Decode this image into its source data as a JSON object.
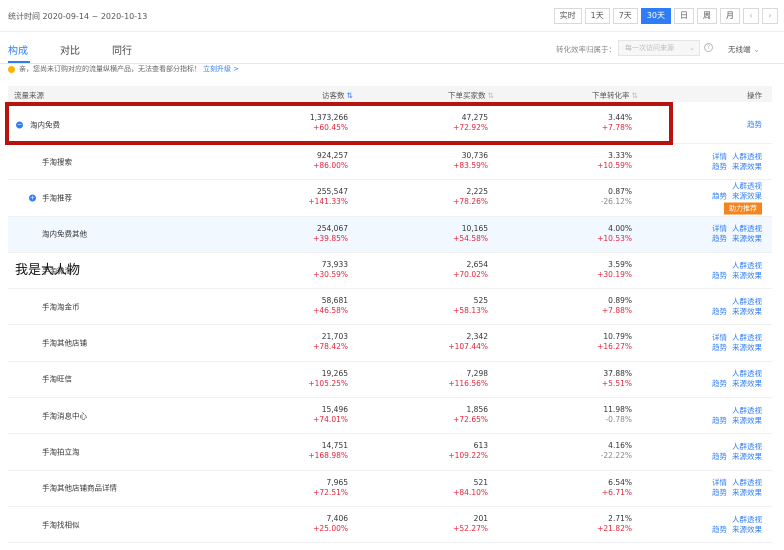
{
  "header": {
    "stat_time_label": "统计时间 2020-09-14 ~ 2020-10-13",
    "ranges": [
      {
        "label": "实时"
      },
      {
        "label": "1天"
      },
      {
        "label": "7天"
      },
      {
        "label": "30天",
        "active": true
      },
      {
        "label": "日"
      },
      {
        "label": "周"
      },
      {
        "label": "月"
      }
    ],
    "prev_arrow": "‹",
    "next_arrow": "›"
  },
  "tabs": [
    {
      "label": "构成",
      "active": true
    },
    {
      "label": "对比"
    },
    {
      "label": "同行"
    }
  ],
  "filter": {
    "label": "转化效率归属于：",
    "select_value": "每一次访问来源",
    "terminal": "无线端"
  },
  "notice": {
    "text": "亲，您尚未订购对应的流量纵横产品，无法查看部分指标！",
    "link": "立刻升级 >"
  },
  "table": {
    "headers": {
      "source": "流量来源",
      "visitors": "访客数",
      "buyers": "下单买家数",
      "conversion": "下单转化率",
      "actions": "操作"
    },
    "rows": [
      {
        "name": "淘内免费",
        "visitors": "1,373,266",
        "visitors_change": "+60.45%",
        "buyers": "47,275",
        "buyers_change": "+72.92%",
        "conv": "3.44%",
        "conv_change": "+7.78%",
        "ops": [
          "趋势"
        ]
      },
      {
        "name": "手淘搜索",
        "visitors": "924,257",
        "visitors_change": "+86.00%",
        "buyers": "30,736",
        "buyers_change": "+83.59%",
        "conv": "3.33%",
        "conv_change": "+10.59%",
        "ops": [
          "详情",
          "人群透视",
          "趋势",
          "来源效果"
        ]
      },
      {
        "name": "手淘推荐",
        "visitors": "255,547",
        "visitors_change": "+141.33%",
        "buyers": "2,225",
        "buyers_change": "+78.26%",
        "conv": "0.87%",
        "conv_change": "-26.12%",
        "ops": [
          "人群透视",
          "趋势",
          "来源效果"
        ],
        "boost": "助力推荐"
      },
      {
        "name": "淘内免费其他",
        "visitors": "254,067",
        "visitors_change": "+39.85%",
        "buyers": "10,165",
        "buyers_change": "+54.58%",
        "conv": "4.00%",
        "conv_change": "+10.53%",
        "ops": [
          "详情",
          "人群透视",
          "趋势",
          "来源效果"
        ]
      },
      {
        "name": "手淘微淘",
        "visitors": "73,933",
        "visitors_change": "+30.59%",
        "buyers": "2,654",
        "buyers_change": "+70.02%",
        "conv": "3.59%",
        "conv_change": "+30.19%",
        "ops": [
          "人群透视",
          "趋势",
          "来源效果"
        ]
      },
      {
        "name": "手淘淘金币",
        "visitors": "58,681",
        "visitors_change": "+46.58%",
        "buyers": "525",
        "buyers_change": "+58.13%",
        "conv": "0.89%",
        "conv_change": "+7.88%",
        "ops": [
          "人群透视",
          "趋势",
          "来源效果"
        ]
      },
      {
        "name": "手淘其他店铺",
        "visitors": "21,703",
        "visitors_change": "+78.42%",
        "buyers": "2,342",
        "buyers_change": "+107.44%",
        "conv": "10.79%",
        "conv_change": "+16.27%",
        "ops": [
          "详情",
          "人群透视",
          "趋势",
          "来源效果"
        ]
      },
      {
        "name": "手淘旺信",
        "visitors": "19,265",
        "visitors_change": "+105.25%",
        "buyers": "7,298",
        "buyers_change": "+116.56%",
        "conv": "37.88%",
        "conv_change": "+5.51%",
        "ops": [
          "人群透视",
          "趋势",
          "来源效果"
        ]
      },
      {
        "name": "手淘消息中心",
        "visitors": "15,496",
        "visitors_change": "+74.01%",
        "buyers": "1,856",
        "buyers_change": "+72.65%",
        "conv": "11.98%",
        "conv_change": "-0.78%",
        "ops": [
          "人群透视",
          "趋势",
          "来源效果"
        ]
      },
      {
        "name": "手淘拍立淘",
        "visitors": "14,751",
        "visitors_change": "+168.98%",
        "buyers": "613",
        "buyers_change": "+109.22%",
        "conv": "4.16%",
        "conv_change": "-22.22%",
        "ops": [
          "人群透视",
          "趋势",
          "来源效果"
        ]
      },
      {
        "name": "手淘其他店铺商品详情",
        "visitors": "7,965",
        "visitors_change": "+72.51%",
        "buyers": "521",
        "buyers_change": "+84.10%",
        "conv": "6.54%",
        "conv_change": "+6.71%",
        "ops": [
          "详情",
          "人群透视",
          "趋势",
          "来源效果"
        ]
      },
      {
        "name": "手淘找相似",
        "visitors": "7,406",
        "visitors_change": "+25.00%",
        "buyers": "201",
        "buyers_change": "+52.27%",
        "conv": "2.71%",
        "conv_change": "+21.82%",
        "ops": [
          "人群透视",
          "趋势",
          "来源效果"
        ]
      }
    ]
  },
  "overlay_caption": "我是大人物",
  "colors": {
    "accent": "#2f7df6",
    "up": "#e5253c",
    "highlight_box": "#b5140f",
    "boost": "#f5841f"
  }
}
